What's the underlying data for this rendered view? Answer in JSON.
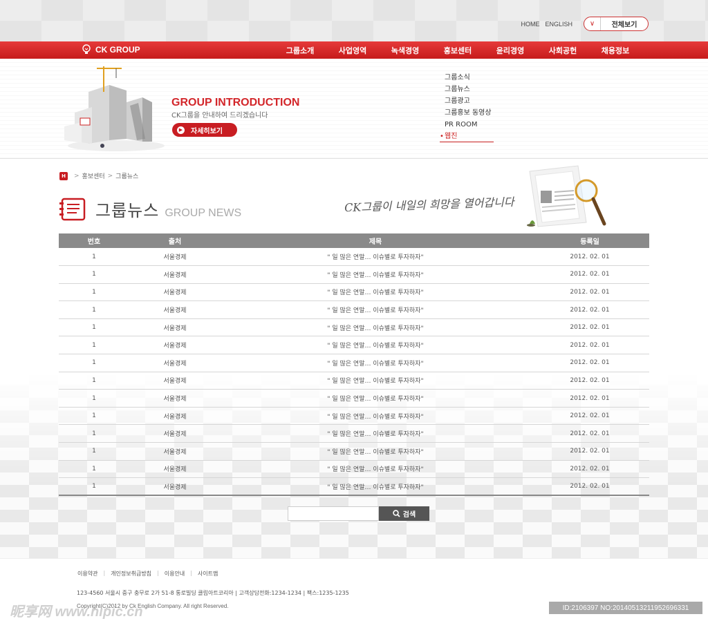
{
  "util": {
    "home": "HOME",
    "english": "ENGLISH",
    "all_view": "전체보기"
  },
  "brand": {
    "logo": "CK GROUP"
  },
  "nav": {
    "items": [
      "그룹소개",
      "사업영역",
      "녹색경영",
      "홍보센터",
      "윤리경영",
      "사회공헌",
      "채용정보"
    ]
  },
  "hero": {
    "title": "GROUP INTRODUCTION",
    "subtitle": "CK그룹을 안내하여 드리겠습니다",
    "button": "자세히보기"
  },
  "submenu": {
    "items": [
      "그룹소식",
      "그룹뉴스",
      "그룹광고",
      "그룹홍보 동영상",
      "PR ROOM",
      "웹진"
    ],
    "active_index": 5
  },
  "breadcrumb": {
    "home": "H",
    "items": [
      "홍보센터",
      "그룹뉴스"
    ]
  },
  "page": {
    "title_ko": "그룹뉴스",
    "title_en": "GROUP NEWS",
    "slogan": "CK그룹이 내일의 희망을 열어갑니다"
  },
  "table": {
    "headers": [
      "번호",
      "출처",
      "제목",
      "등록일"
    ],
    "rows": [
      [
        "1",
        "서울경제",
        "\" 일 많은 연말… 이슈별로 투자하자\"",
        "2012. 02. 01"
      ],
      [
        "1",
        "서울경제",
        "\" 일 많은 연말… 이슈별로 투자하자\"",
        "2012. 02. 01"
      ],
      [
        "1",
        "서울경제",
        "\" 일 많은 연말… 이슈별로 투자하자\"",
        "2012. 02. 01"
      ],
      [
        "1",
        "서울경제",
        "\" 일 많은 연말… 이슈별로 투자하자\"",
        "2012. 02. 01"
      ],
      [
        "1",
        "서울경제",
        "\" 일 많은 연말… 이슈별로 투자하자\"",
        "2012. 02. 01"
      ],
      [
        "1",
        "서울경제",
        "\" 일 많은 연말… 이슈별로 투자하자\"",
        "2012. 02. 01"
      ],
      [
        "1",
        "서울경제",
        "\" 일 많은 연말… 이슈별로 투자하자\"",
        "2012. 02. 01"
      ],
      [
        "1",
        "서울경제",
        "\" 일 많은 연말… 이슈별로 투자하자\"",
        "2012. 02. 01"
      ],
      [
        "1",
        "서울경제",
        "\" 일 많은 연말… 이슈별로 투자하자\"",
        "2012. 02. 01"
      ],
      [
        "1",
        "서울경제",
        "\" 일 많은 연말… 이슈별로 투자하자\"",
        "2012. 02. 01"
      ],
      [
        "1",
        "서울경제",
        "\" 일 많은 연말… 이슈별로 투자하자\"",
        "2012. 02. 01"
      ],
      [
        "1",
        "서울경제",
        "\" 일 많은 연말… 이슈별로 투자하자\"",
        "2012. 02. 01"
      ],
      [
        "1",
        "서울경제",
        "\" 일 많은 연말… 이슈별로 투자하자\"",
        "2012. 02. 01"
      ],
      [
        "1",
        "서울경제",
        "\" 일 많은 연말… 이슈별로 투자하자\"",
        "2012. 02. 01"
      ]
    ]
  },
  "search": {
    "value": "",
    "button": "검색",
    "icon": "search-icon"
  },
  "footer": {
    "links": [
      "이용약관",
      "개인정보취급방침",
      "이용안내",
      "사이트맵"
    ],
    "address": "123-4560 서울시 중구 충무로 2가 51-8 통로빌딩 클립아트코리아  |  고객상담전화:1234-1234  |  팩스:1235-1235",
    "copyright": "Copyright(C)2012 by Ck English  Company. All right Reserved."
  },
  "watermark": {
    "left": "昵享网 www.nipic.cn",
    "right": "ID:2106397 NO:20140513211952696331"
  },
  "colors": {
    "accent": "#c81d22",
    "table_header": "#8a8a8a",
    "nav_red": "#d62a2a"
  }
}
